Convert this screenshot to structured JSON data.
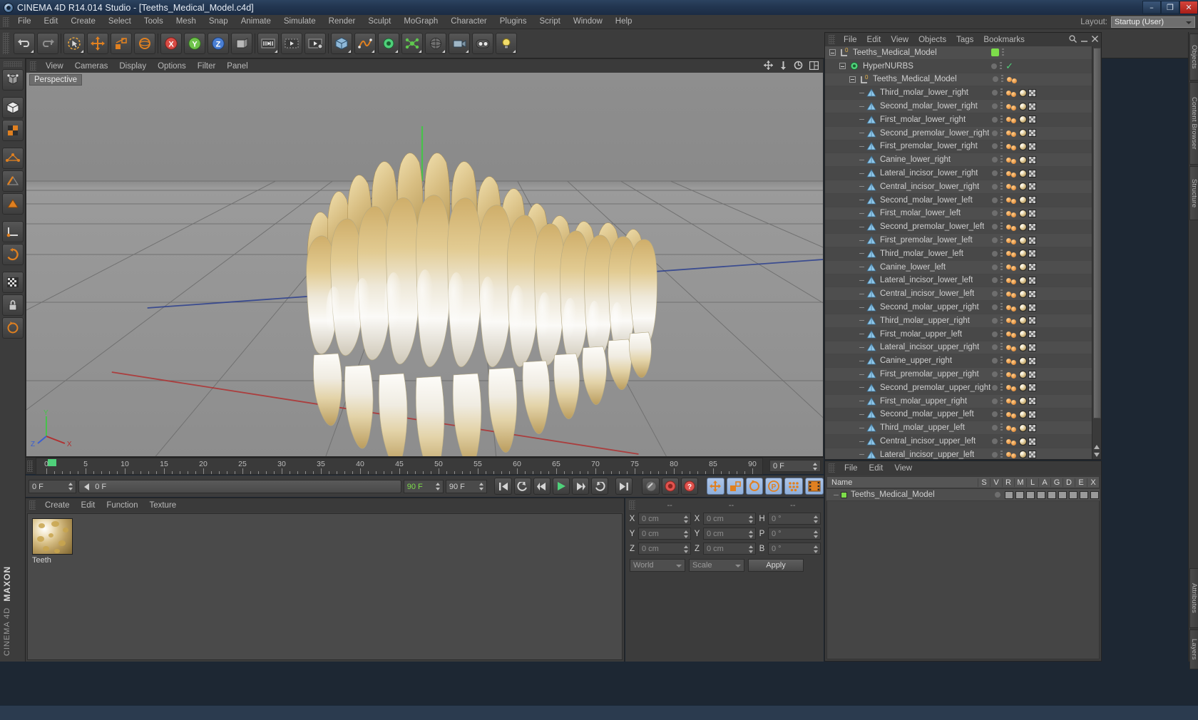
{
  "window": {
    "title": "CINEMA 4D R14.014 Studio - [Teeths_Medical_Model.c4d]",
    "app_icon": "c4d-logo-icon",
    "buttons": {
      "minimize": "–",
      "maximize": "❐",
      "close": "✕"
    }
  },
  "menubar": {
    "items": [
      "File",
      "Edit",
      "Create",
      "Select",
      "Tools",
      "Mesh",
      "Snap",
      "Animate",
      "Simulate",
      "Render",
      "Sculpt",
      "MoGraph",
      "Character",
      "Plugins",
      "Script",
      "Window",
      "Help"
    ],
    "layout_label": "Layout:",
    "layout_value": "Startup (User)"
  },
  "toolbar": {
    "buttons": [
      {
        "name": "undo-button",
        "icon": "undo-arrow-icon"
      },
      {
        "name": "redo-button",
        "icon": "redo-arrow-icon"
      },
      {
        "name": "live-selection-button",
        "icon": "cursor-select-icon"
      },
      {
        "name": "move-button",
        "icon": "move-axis-icon"
      },
      {
        "name": "scale-button",
        "icon": "scale-icon"
      },
      {
        "name": "rotate-button",
        "icon": "rotate-icon"
      },
      {
        "name": "lock-x-axis-button",
        "icon": "axis-x-icon",
        "label": "X"
      },
      {
        "name": "lock-y-axis-button",
        "icon": "axis-y-icon",
        "label": "Y"
      },
      {
        "name": "lock-z-axis-button",
        "icon": "axis-z-icon",
        "label": "Z"
      },
      {
        "name": "world-object-coordinates-button",
        "icon": "world-coord-icon"
      },
      {
        "name": "render-view-button",
        "icon": "render-view-icon"
      },
      {
        "name": "render-region-button",
        "icon": "render-region-icon"
      },
      {
        "name": "render-settings-button",
        "icon": "render-settings-icon"
      },
      {
        "name": "add-cube-button",
        "icon": "cube-icon"
      },
      {
        "name": "add-spline-button",
        "icon": "spline-icon"
      },
      {
        "name": "add-nurbs-button",
        "icon": "hypernurbs-icon"
      },
      {
        "name": "add-modeling-object-button",
        "icon": "array-icon"
      },
      {
        "name": "add-scene-object-button",
        "icon": "scene-icon"
      },
      {
        "name": "add-camera-button",
        "icon": "camera-icon"
      },
      {
        "name": "add-stage-button",
        "icon": "stage-icon"
      },
      {
        "name": "add-light-button",
        "icon": "light-bulb-icon"
      }
    ]
  },
  "left_toolbar": {
    "buttons": [
      {
        "name": "make-editable-button",
        "icon": "make-editable-icon"
      },
      {
        "name": "model-mode-button",
        "icon": "model-cube-icon"
      },
      {
        "name": "texture-mode-button",
        "icon": "texture-checker-icon"
      },
      {
        "name": "points-mode-button",
        "icon": "points-icon"
      },
      {
        "name": "edges-mode-button",
        "icon": "edges-icon"
      },
      {
        "name": "polygons-mode-button",
        "icon": "polygons-icon"
      },
      {
        "name": "object-axis-mode-button",
        "icon": "object-axis-icon"
      },
      {
        "name": "workplane-button",
        "icon": "workplane-icon"
      },
      {
        "name": "enable-axis-button",
        "icon": "enable-axis-icon"
      },
      {
        "name": "viewport-solo-button",
        "icon": "viewport-solo-icon"
      },
      {
        "name": "lock-button",
        "icon": "padlock-icon"
      },
      {
        "name": "animation-mode-button",
        "icon": "animation-mode-icon"
      }
    ],
    "branding_top": "MAXON",
    "branding_bottom": "CINEMA 4D"
  },
  "viewport": {
    "menu": [
      "View",
      "Cameras",
      "Display",
      "Options",
      "Filter",
      "Panel"
    ],
    "label": "Perspective",
    "corner_icons": [
      "move-view-icon",
      "scale-view-icon",
      "rotate-view-icon",
      "toggle-layout-icon"
    ],
    "axis_gizmo": {
      "y": "Y",
      "x": "X",
      "z": "Z"
    },
    "model_name": "Teeths_Medical_Model"
  },
  "timeline": {
    "ticks": [
      0,
      5,
      10,
      15,
      20,
      25,
      30,
      35,
      40,
      45,
      50,
      55,
      60,
      65,
      70,
      75,
      80,
      85,
      90
    ],
    "min_frame": 0,
    "max_frame": 90,
    "current_frame_field": "0 F",
    "playhead_frame": 0
  },
  "transport": {
    "current_frame": "0 F",
    "start_frame": "0 F",
    "preview_end": "90 F",
    "end_frame": "90 F",
    "buttons": [
      {
        "name": "go-to-start-button",
        "icon": "skip-start-icon"
      },
      {
        "name": "previous-key-button",
        "icon": "prev-key-icon"
      },
      {
        "name": "step-back-button",
        "icon": "step-back-icon"
      },
      {
        "name": "play-button",
        "icon": "play-icon"
      },
      {
        "name": "step-forward-button",
        "icon": "step-forward-icon"
      },
      {
        "name": "next-key-button",
        "icon": "next-key-icon"
      },
      {
        "name": "go-to-end-button",
        "icon": "skip-end-icon"
      },
      {
        "name": "autokey-button",
        "icon": "autokey-icon"
      },
      {
        "name": "record-button",
        "icon": "record-icon"
      },
      {
        "name": "keyframe-selection-button",
        "icon": "keyframe-select-icon"
      },
      {
        "name": "position-key-button",
        "icon": "position-key-icon"
      },
      {
        "name": "scale-key-button",
        "icon": "scale-key-icon"
      },
      {
        "name": "rotation-key-button",
        "icon": "rotation-key-icon"
      },
      {
        "name": "parameter-key-button",
        "icon": "parameter-key-icon"
      },
      {
        "name": "point-level-animation-button",
        "icon": "pla-icon"
      },
      {
        "name": "timeline-toggle-button",
        "icon": "timeline-icon"
      }
    ]
  },
  "material_manager": {
    "menu": [
      "Create",
      "Edit",
      "Function",
      "Texture"
    ],
    "materials": [
      {
        "name": "Teeth",
        "thumbnail": "teeth-material-sphere"
      }
    ]
  },
  "coordinates": {
    "header": [
      "--",
      "--",
      "--"
    ],
    "rows": [
      {
        "label1": "X",
        "value1": "0 cm",
        "label2": "X",
        "value2": "0 cm",
        "label3": "H",
        "value3": "0 °"
      },
      {
        "label1": "Y",
        "value1": "0 cm",
        "label2": "Y",
        "value2": "0 cm",
        "label3": "P",
        "value3": "0 °"
      },
      {
        "label1": "Z",
        "value1": "0 cm",
        "label2": "Z",
        "value2": "0 cm",
        "label3": "B",
        "value3": "0 °"
      }
    ],
    "system": "World",
    "mode": "Scale",
    "apply": "Apply"
  },
  "object_manager": {
    "menu": [
      "File",
      "Edit",
      "View",
      "Objects",
      "Tags",
      "Bookmarks"
    ],
    "right_icons": [
      "search-icon",
      "minimize-icon",
      "close-icon"
    ],
    "tree": [
      {
        "name": "Teeths_Medical_Model",
        "depth": 0,
        "icon": "null-object-icon",
        "expander": true,
        "state": "green-square"
      },
      {
        "name": "HyperNURBS",
        "depth": 1,
        "icon": "hypernurbs-icon",
        "expander": true,
        "state": "check"
      },
      {
        "name": "Teeths_Medical_Model",
        "depth": 2,
        "icon": "null-object-icon",
        "expander": true,
        "state": "dots"
      },
      {
        "name": "Third_molar_lower_right",
        "depth": 3,
        "icon": "polygon-object-icon",
        "state": "tags"
      },
      {
        "name": "Second_molar_lower_right",
        "depth": 3,
        "icon": "polygon-object-icon",
        "state": "tags"
      },
      {
        "name": "First_molar_lower_right",
        "depth": 3,
        "icon": "polygon-object-icon",
        "state": "tags"
      },
      {
        "name": "Second_premolar_lower_right",
        "depth": 3,
        "icon": "polygon-object-icon",
        "state": "tags"
      },
      {
        "name": "First_premolar_lower_right",
        "depth": 3,
        "icon": "polygon-object-icon",
        "state": "tags"
      },
      {
        "name": "Canine_lower_right",
        "depth": 3,
        "icon": "polygon-object-icon",
        "state": "tags"
      },
      {
        "name": "Lateral_incisor_lower_right",
        "depth": 3,
        "icon": "polygon-object-icon",
        "state": "tags"
      },
      {
        "name": "Central_incisor_lower_right",
        "depth": 3,
        "icon": "polygon-object-icon",
        "state": "tags"
      },
      {
        "name": "Second_molar_lower_left",
        "depth": 3,
        "icon": "polygon-object-icon",
        "state": "tags"
      },
      {
        "name": "First_molar_lower_left",
        "depth": 3,
        "icon": "polygon-object-icon",
        "state": "tags"
      },
      {
        "name": "Second_premolar_lower_left",
        "depth": 3,
        "icon": "polygon-object-icon",
        "state": "tags"
      },
      {
        "name": "First_premolar_lower_left",
        "depth": 3,
        "icon": "polygon-object-icon",
        "state": "tags"
      },
      {
        "name": "Third_molar_lower_left",
        "depth": 3,
        "icon": "polygon-object-icon",
        "state": "tags"
      },
      {
        "name": "Canine_lower_left",
        "depth": 3,
        "icon": "polygon-object-icon",
        "state": "tags"
      },
      {
        "name": "Lateral_incisor_lower_left",
        "depth": 3,
        "icon": "polygon-object-icon",
        "state": "tags"
      },
      {
        "name": "Central_incisor_lower_left",
        "depth": 3,
        "icon": "polygon-object-icon",
        "state": "tags"
      },
      {
        "name": "Second_molar_upper_right",
        "depth": 3,
        "icon": "polygon-object-icon",
        "state": "tags"
      },
      {
        "name": "Third_molar_upper_right",
        "depth": 3,
        "icon": "polygon-object-icon",
        "state": "tags"
      },
      {
        "name": "First_molar_upper_left",
        "depth": 3,
        "icon": "polygon-object-icon",
        "state": "tags"
      },
      {
        "name": "Lateral_incisor_upper_right",
        "depth": 3,
        "icon": "polygon-object-icon",
        "state": "tags"
      },
      {
        "name": "Canine_upper_right",
        "depth": 3,
        "icon": "polygon-object-icon",
        "state": "tags"
      },
      {
        "name": "First_premolar_upper_right",
        "depth": 3,
        "icon": "polygon-object-icon",
        "state": "tags"
      },
      {
        "name": "Second_premolar_upper_right",
        "depth": 3,
        "icon": "polygon-object-icon",
        "state": "tags"
      },
      {
        "name": "First_molar_upper_right",
        "depth": 3,
        "icon": "polygon-object-icon",
        "state": "tags"
      },
      {
        "name": "Second_molar_upper_left",
        "depth": 3,
        "icon": "polygon-object-icon",
        "state": "tags"
      },
      {
        "name": "Third_molar_upper_left",
        "depth": 3,
        "icon": "polygon-object-icon",
        "state": "tags"
      },
      {
        "name": "Central_incisor_upper_left",
        "depth": 3,
        "icon": "polygon-object-icon",
        "state": "tags"
      },
      {
        "name": "Lateral_incisor_upper_left",
        "depth": 3,
        "icon": "polygon-object-icon",
        "state": "tags"
      }
    ]
  },
  "attribute_manager": {
    "menu": [
      "File",
      "Edit",
      "View"
    ],
    "columns": [
      "Name",
      "S",
      "V",
      "R",
      "M",
      "L",
      "A",
      "G",
      "D",
      "E",
      "X"
    ],
    "rows": [
      {
        "name": "Teeths_Medical_Model",
        "color": "#7ddc4a"
      }
    ]
  },
  "right_tabs": [
    "Objects",
    "Content Browser",
    "Structure",
    "Attributes",
    "Layers"
  ],
  "colors": {
    "accent_orange": "#e08020",
    "selection_blue": "#aec6e8",
    "green_tag": "#7ddc4a",
    "panel_bg": "#3c3c3c",
    "viewport_bg": "#8c8c8c"
  }
}
